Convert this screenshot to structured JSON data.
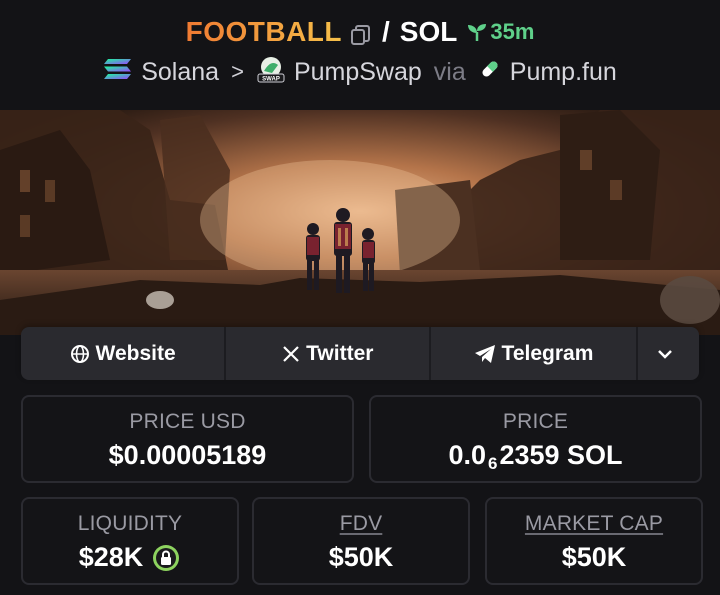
{
  "header": {
    "base_symbol": "FOOTBALL",
    "slash": "/",
    "quote_symbol": "SOL",
    "age": "35m",
    "chain": "Solana",
    "separator": ">",
    "dex": "PumpSwap",
    "via": "via",
    "launchpad": "Pump.fun",
    "dex_badge": "SWAP"
  },
  "links": {
    "website": "Website",
    "twitter": "Twitter",
    "telegram": "Telegram"
  },
  "stats": {
    "price_usd_label": "PRICE USD",
    "price_usd_value": "$0.00005189",
    "price_label": "PRICE",
    "price_prefix": "0.0",
    "price_zeros": "6",
    "price_suffix": "2359 SOL",
    "liquidity_label": "LIQUIDITY",
    "liquidity_value": "$28K",
    "fdv_label": "FDV",
    "fdv_value": "$50K",
    "mcap_label": "MARKET CAP",
    "mcap_value": "$50K"
  },
  "colors": {
    "accent_orange": "#f5a23a",
    "age_green": "#5fd08a",
    "lock_green": "#8dd35f"
  }
}
